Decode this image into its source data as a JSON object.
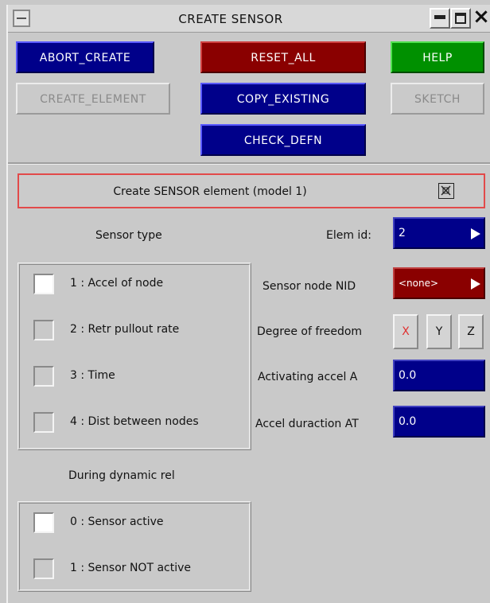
{
  "window": {
    "title": "CREATE SENSOR"
  },
  "toolbar": {
    "abort_create": "ABORT_CREATE",
    "reset_all": "RESET_ALL",
    "help": "HELP",
    "create_element": "CREATE_ELEMENT",
    "copy_existing": "COPY_EXISTING",
    "sketch": "SKETCH",
    "check_defn": "CHECK_DEFN"
  },
  "header": {
    "text": "Create SENSOR element (model 1)"
  },
  "sensor_type": {
    "label": "Sensor type",
    "options": [
      {
        "label": "1 : Accel of node",
        "checked": true
      },
      {
        "label": "2 : Retr pullout rate",
        "checked": false
      },
      {
        "label": "3 : Time",
        "checked": false
      },
      {
        "label": "4 : Dist between nodes",
        "checked": false
      }
    ]
  },
  "fields": {
    "elem_id": {
      "label": "Elem id:",
      "value": "2"
    },
    "sensor_node": {
      "label": "Sensor node NID",
      "value": "<none>"
    },
    "dof": {
      "label": "Degree of freedom",
      "options": [
        "X",
        "Y",
        "Z"
      ],
      "selected": "X"
    },
    "accel_a": {
      "label": "Activating accel A",
      "value": "0.0"
    },
    "accel_at": {
      "label": "Accel duraction AT",
      "value": "0.0"
    }
  },
  "dynamic": {
    "label": "During dynamic rel",
    "options": [
      {
        "label": "0 : Sensor active",
        "checked": true
      },
      {
        "label": "1 : Sensor NOT active",
        "checked": false
      }
    ]
  },
  "colors": {
    "blue": "#00008a",
    "red": "#8a0000",
    "green": "#009000",
    "highlight_border": "#e24a4a",
    "dof_selected": "#e03030"
  }
}
